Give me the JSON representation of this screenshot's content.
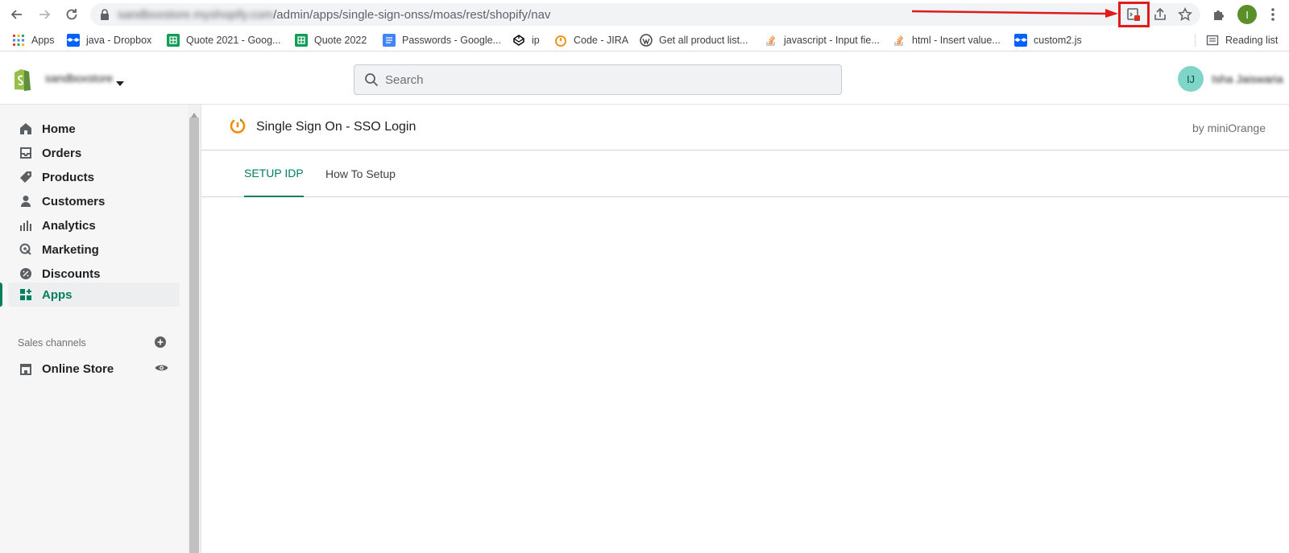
{
  "browser": {
    "url_host": "sandboxstore.myshopify.com",
    "url_path": "/admin/apps/single-sign-onss/moas/rest/shopify/nav",
    "profile_initial": "I",
    "highlight_color": "#e01b1b"
  },
  "bookmarks": [
    {
      "label": "Apps",
      "icon": "grid-icon"
    },
    {
      "label": "java - Dropbox",
      "icon": "dropbox-icon"
    },
    {
      "label": "Quote 2021 - Goog...",
      "icon": "sheets-icon"
    },
    {
      "label": "Quote 2022",
      "icon": "sheets-icon"
    },
    {
      "label": "Passwords - Google...",
      "icon": "docs-icon"
    },
    {
      "label": "ip",
      "icon": "codepen-icon"
    },
    {
      "label": "Code - JIRA",
      "icon": "jira-icon"
    },
    {
      "label": "Get all product list...",
      "icon": "wordpress-icon"
    },
    {
      "label": "javascript - Input fie...",
      "icon": "stackoverflow-icon"
    },
    {
      "label": "html - Insert value...",
      "icon": "stackoverflow-icon"
    },
    {
      "label": "custom2.js",
      "icon": "dropbox-icon"
    },
    {
      "label": "Reading list",
      "icon": "reading-list-icon"
    }
  ],
  "shopify": {
    "store_name": "sandboxstore",
    "search_placeholder": "Search",
    "user_initials": "IJ",
    "user_name": "Isha Jaiswaria",
    "accent": "#007f5f"
  },
  "sidebar": {
    "items": [
      {
        "label": "Home",
        "icon": "home-icon"
      },
      {
        "label": "Orders",
        "icon": "orders-icon"
      },
      {
        "label": "Products",
        "icon": "tag-icon"
      },
      {
        "label": "Customers",
        "icon": "person-icon"
      },
      {
        "label": "Analytics",
        "icon": "bar-chart-icon"
      },
      {
        "label": "Marketing",
        "icon": "target-icon"
      },
      {
        "label": "Discounts",
        "icon": "percent-icon"
      },
      {
        "label": "Apps",
        "icon": "apps-icon",
        "active": true
      }
    ],
    "sales_channels_label": "Sales channels",
    "online_store_label": "Online Store"
  },
  "app": {
    "title": "Single Sign On - SSO Login",
    "by_line": "by miniOrange",
    "tabs": [
      {
        "label": "SETUP IDP",
        "active": true
      },
      {
        "label": "How To Setup",
        "active": false
      }
    ]
  }
}
